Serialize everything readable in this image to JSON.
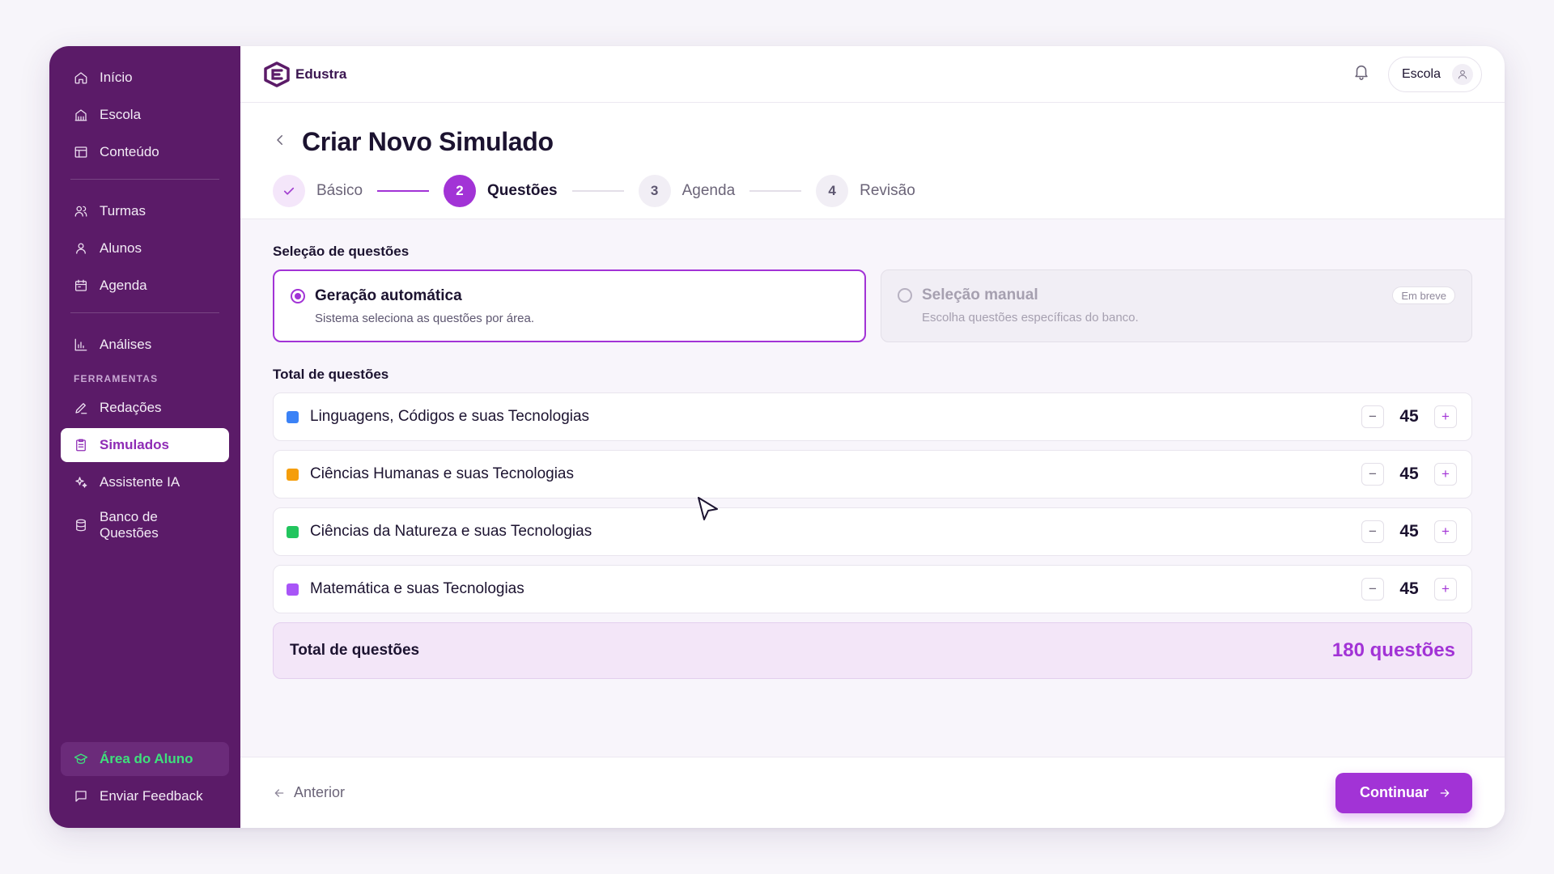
{
  "sidebar": {
    "items": [
      {
        "label": "Início",
        "icon": "home-icon"
      },
      {
        "label": "Escola",
        "icon": "building-icon"
      },
      {
        "label": "Conteúdo",
        "icon": "layout-icon"
      },
      {
        "label": "Turmas",
        "icon": "users-icon"
      },
      {
        "label": "Alunos",
        "icon": "user-icon"
      },
      {
        "label": "Agenda",
        "icon": "calendar-icon"
      },
      {
        "label": "Análises",
        "icon": "bar-chart-icon"
      },
      {
        "label": "Redações",
        "icon": "pen-icon"
      },
      {
        "label": "Simulados",
        "icon": "clipboard-icon"
      },
      {
        "label": "Assistente IA",
        "icon": "sparkles-icon"
      },
      {
        "label": "Banco de Questões",
        "icon": "database-icon"
      }
    ],
    "section_label": "FERRAMENTAS",
    "active_item": "Simulados",
    "student_area": "Área do Aluno",
    "feedback": "Enviar Feedback",
    "accent_green": "#3ee07c"
  },
  "header": {
    "brand": "Edustra",
    "school_label": "Escola"
  },
  "page": {
    "title": "Criar Novo Simulado",
    "steps": [
      {
        "number": "",
        "label": "Básico",
        "state": "done"
      },
      {
        "number": "2",
        "label": "Questões",
        "state": "current"
      },
      {
        "number": "3",
        "label": "Agenda",
        "state": "pending"
      },
      {
        "number": "4",
        "label": "Revisão",
        "state": "pending"
      }
    ]
  },
  "selection": {
    "title": "Seleção de questões",
    "auto": {
      "title": "Geração automática",
      "desc": "Sistema seleciona as questões por área.",
      "selected": true
    },
    "manual": {
      "title": "Seleção manual",
      "desc": "Escolha questões específicas do banco.",
      "badge": "Em breve",
      "selected": false
    }
  },
  "areas": {
    "title": "Total de questões",
    "rows": [
      {
        "name": "Linguagens, Códigos e suas Tecnologias",
        "count": "45",
        "color": "#3b82f6"
      },
      {
        "name": "Ciências Humanas e suas Tecnologias",
        "count": "45",
        "color": "#f59e0b"
      },
      {
        "name": "Ciências da Natureza e suas Tecnologias",
        "count": "45",
        "color": "#22c55e"
      },
      {
        "name": "Matemática e suas Tecnologias",
        "count": "45",
        "color": "#a855f7"
      }
    ],
    "minus": "−",
    "plus": "+"
  },
  "total": {
    "label": "Total de questões",
    "value": "180 questões"
  },
  "footer": {
    "prev": "Anterior",
    "next": "Continuar"
  },
  "colors": {
    "accent": "#a233d6",
    "sidebar_bg": "#5b1b68"
  }
}
